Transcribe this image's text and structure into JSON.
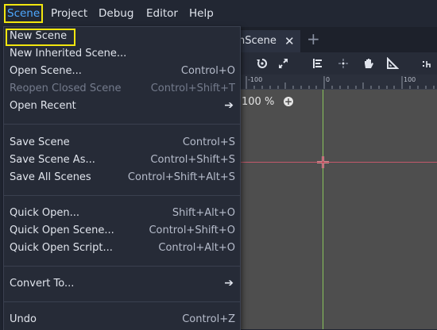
{
  "menubar": {
    "items": [
      "Scene",
      "Project",
      "Debug",
      "Editor",
      "Help"
    ]
  },
  "tab": {
    "label": "nScene",
    "close_icon": "close-icon",
    "add_icon": "plus-icon"
  },
  "toolbar": {
    "icons": [
      "rotate-icon",
      "scale-icon",
      "list-icon",
      "pivot-icon",
      "pan-icon",
      "ruler-icon",
      "snap-icon"
    ]
  },
  "ruler": {
    "labels": [
      "-100",
      "0",
      "100"
    ]
  },
  "viewport": {
    "zoom": "100 %",
    "axis_colors": {
      "vertical": "#88c45c",
      "horizontal": "#c2586a"
    }
  },
  "dropdown": {
    "items": [
      {
        "label": "New Scene",
        "shortcut": ""
      },
      {
        "label": "New Inherited Scene...",
        "shortcut": ""
      },
      {
        "label": "Open Scene...",
        "shortcut": "Control+O"
      },
      {
        "label": "Reopen Closed Scene",
        "shortcut": "Control+Shift+T",
        "disabled": true
      },
      {
        "label": "Open Recent",
        "submenu": true
      },
      {
        "label": "Save Scene",
        "shortcut": "Control+S"
      },
      {
        "label": "Save Scene As...",
        "shortcut": "Control+Shift+S"
      },
      {
        "label": "Save All Scenes",
        "shortcut": "Control+Shift+Alt+S"
      },
      {
        "label": "Quick Open...",
        "shortcut": "Shift+Alt+O"
      },
      {
        "label": "Quick Open Scene...",
        "shortcut": "Control+Shift+O"
      },
      {
        "label": "Quick Open Script...",
        "shortcut": "Control+Alt+O"
      },
      {
        "label": "Convert To...",
        "submenu": true
      },
      {
        "label": "Undo",
        "shortcut": "Control+Z"
      }
    ]
  },
  "colors": {
    "highlight": "#f2e60f",
    "active_menu_text": "#4ea8ff"
  }
}
